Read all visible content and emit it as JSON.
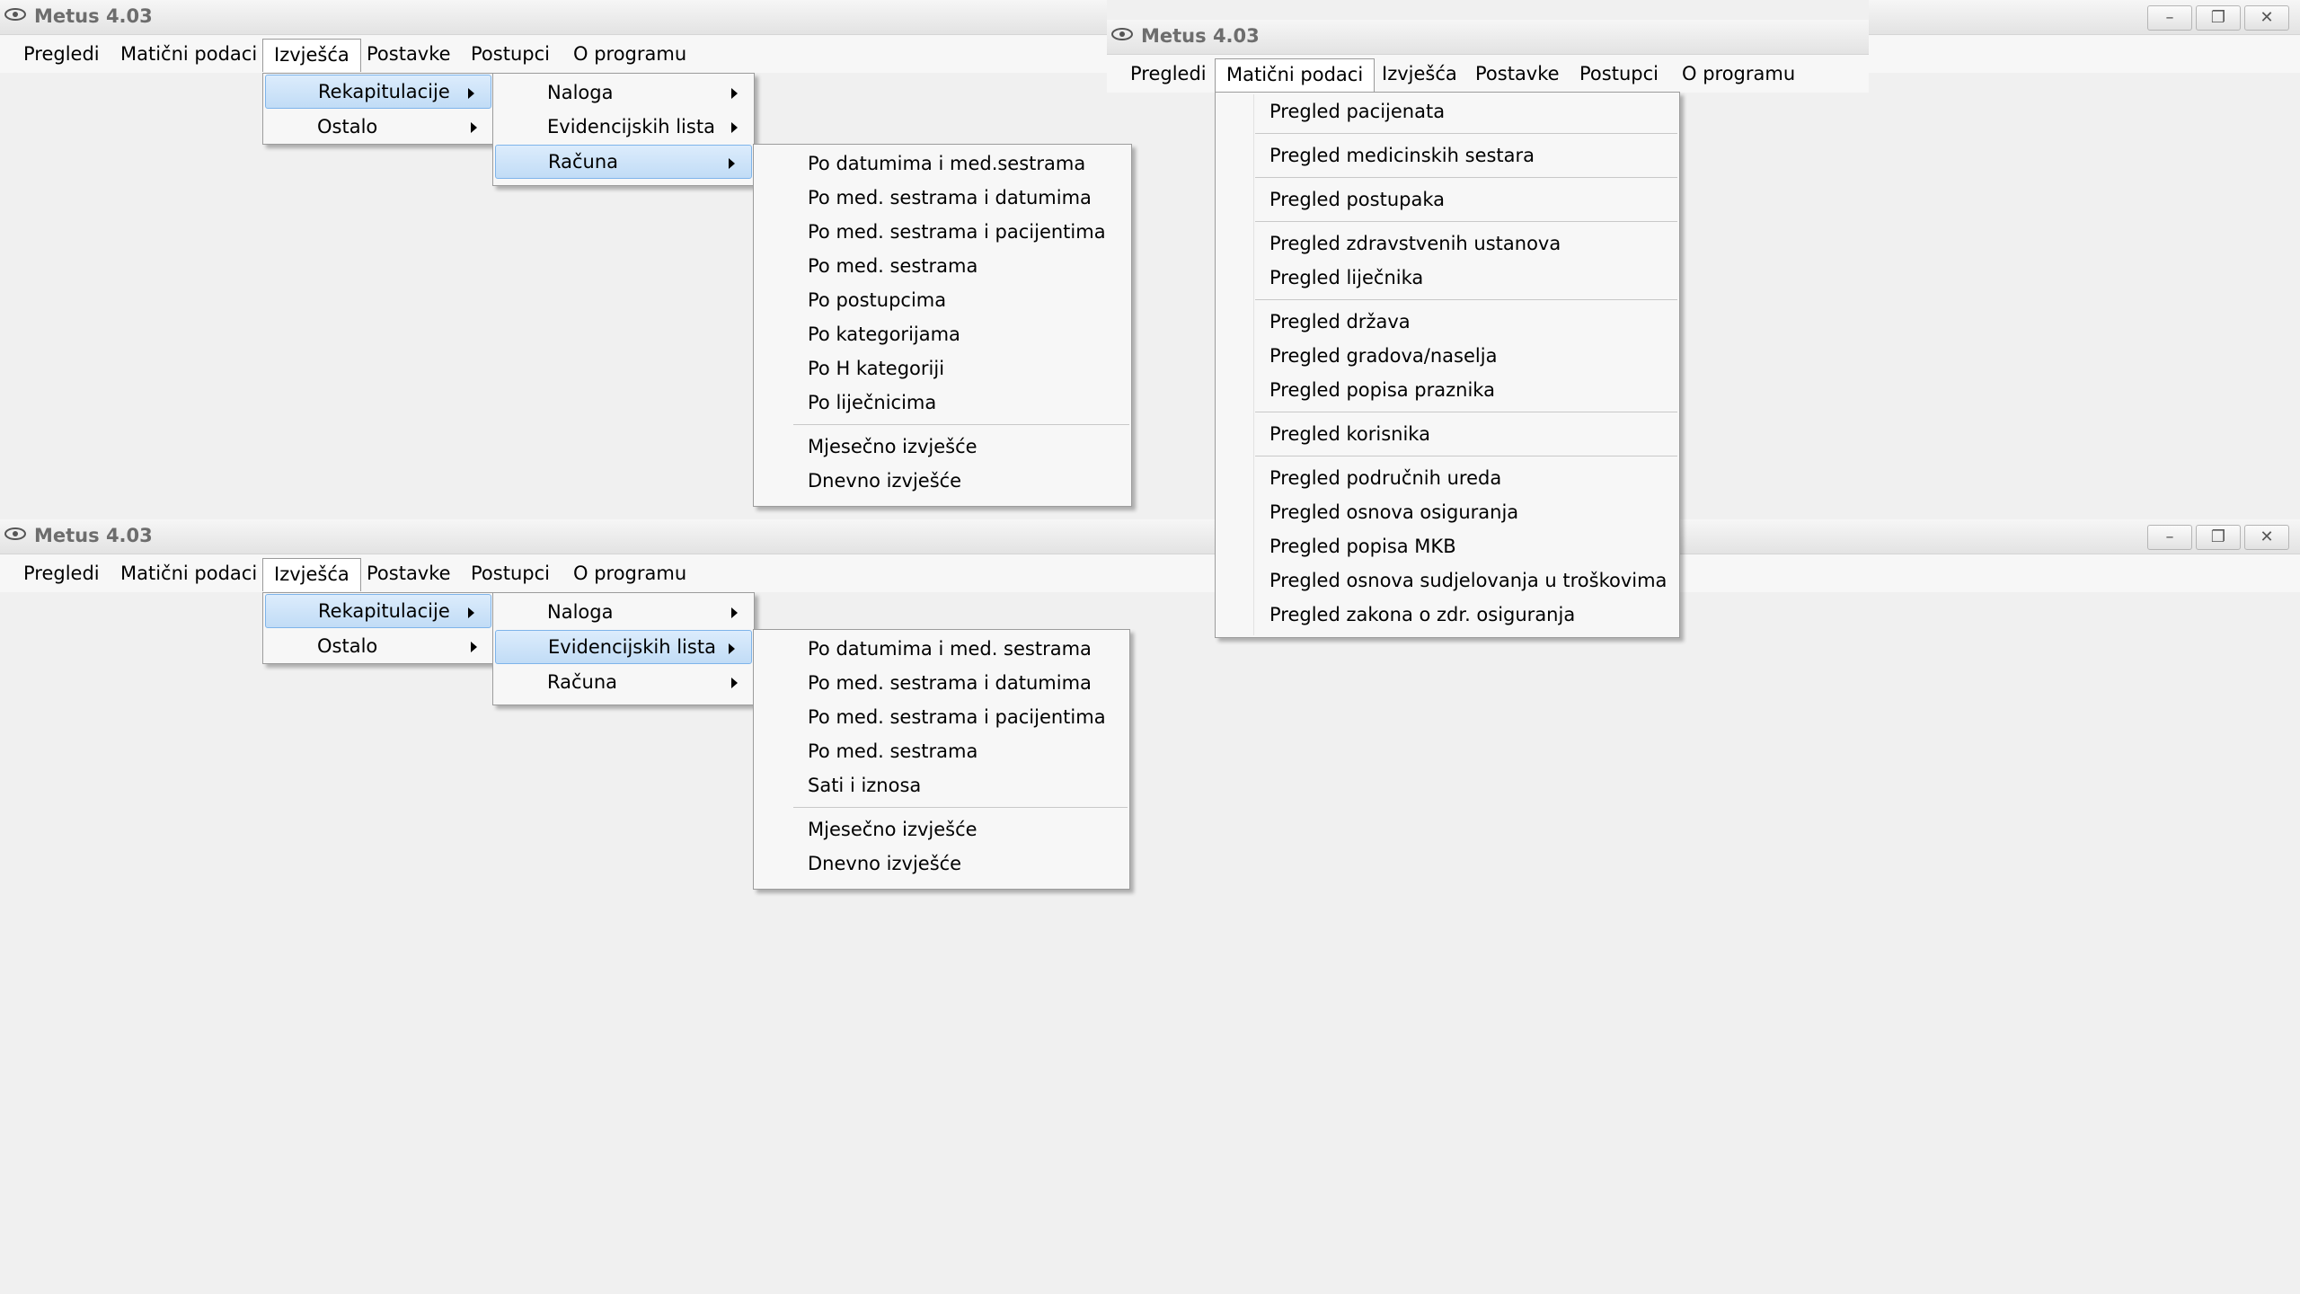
{
  "app": {
    "title": "Metus 4.03"
  },
  "menu": {
    "pregledi": "Pregledi",
    "maticni": "Matični podaci",
    "izvjesca": "Izvješća",
    "postavke": "Postavke",
    "postupci": "Postupci",
    "oprogramu": "O programu"
  },
  "window_controls": {
    "minimize": "–",
    "restore": "❐",
    "close": "✕"
  },
  "izvjesca_menu": [
    "Rekapitulacije",
    "Ostalo"
  ],
  "rekapitulacije_menu": [
    "Naloga",
    "Evidencijskih lista",
    "Računa"
  ],
  "racuna_submenu": {
    "group1": [
      "Po datumima i med.sestrama",
      "Po med. sestrama i datumima",
      "Po med. sestrama i pacijentima",
      "Po med. sestrama",
      "Po postupcima",
      "Po kategorijama",
      "Po H kategoriji",
      "Po liječnicima"
    ],
    "group2": [
      "Mjesečno izvješće",
      "Dnevno izvješće"
    ]
  },
  "evidencijskih_submenu": {
    "group1": [
      "Po datumima i med. sestrama",
      "Po med. sestrama i datumima",
      "Po med. sestrama i pacijentima",
      "Po med. sestrama",
      "Sati i iznosa"
    ],
    "group2": [
      "Mjesečno izvješće",
      "Dnevno izvješće"
    ]
  },
  "maticni_menu": {
    "g1": [
      "Pregled pacijenata"
    ],
    "g2": [
      "Pregled medicinskih sestara"
    ],
    "g3": [
      "Pregled postupaka"
    ],
    "g4": [
      "Pregled zdravstvenih ustanova",
      "Pregled liječnika"
    ],
    "g5": [
      "Pregled država",
      "Pregled gradova/naselja",
      "Pregled popisa  praznika"
    ],
    "g6": [
      "Pregled korisnika"
    ],
    "g7": [
      "Pregled područnih ureda",
      "Pregled osnova osiguranja",
      "Pregled popisa MKB",
      "Pregled osnova sudjelovanja u troškovima",
      "Pregled zakona o zdr. osiguranja"
    ]
  }
}
